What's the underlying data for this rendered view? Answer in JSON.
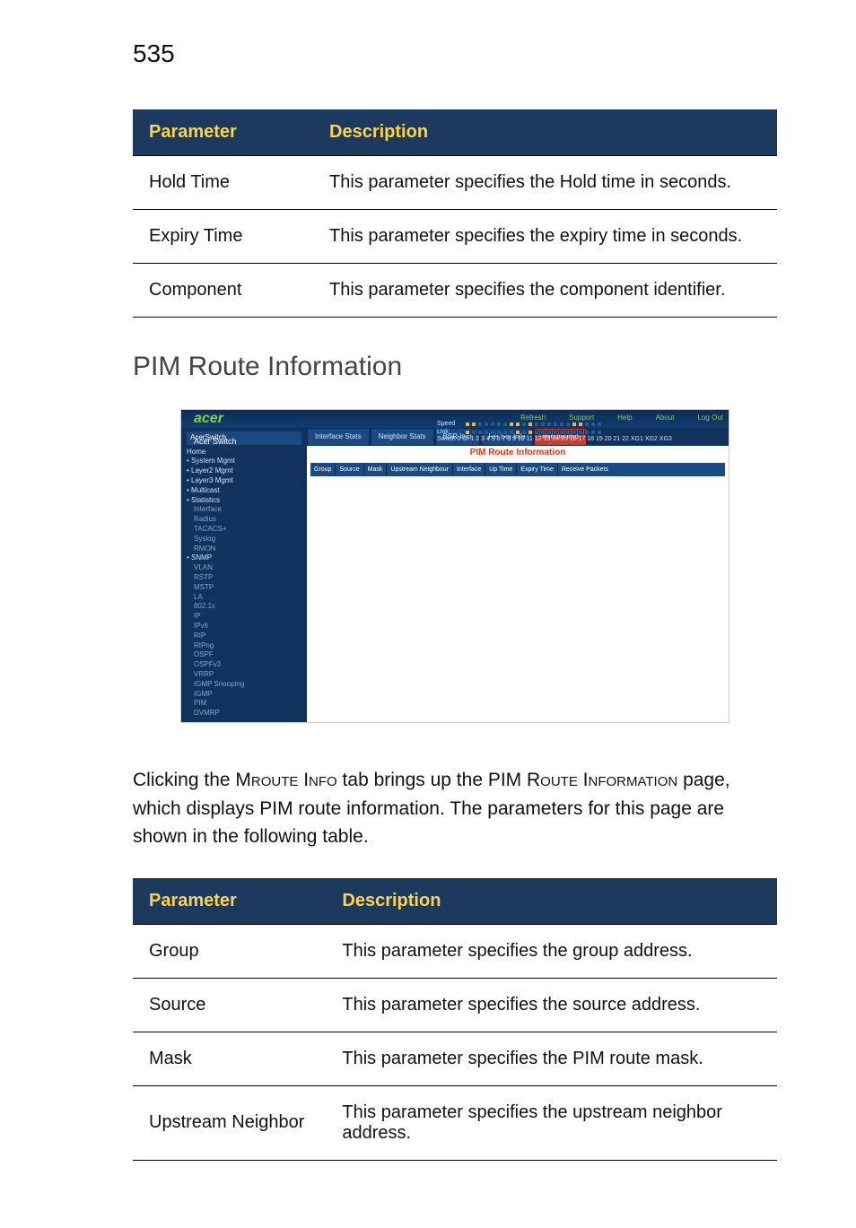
{
  "page_number": "535",
  "table1": {
    "header_param": "Parameter",
    "header_desc": "Description",
    "rows": [
      {
        "p": "Hold Time",
        "d": "This parameter specifies the Hold time in seconds."
      },
      {
        "p": "Expiry Time",
        "d": "This parameter specifies the expiry time in seconds."
      },
      {
        "p": "Component",
        "d": "This parameter specifies the component identifier."
      }
    ]
  },
  "section_title": "PIM Route Information",
  "shot": {
    "brand": "acer",
    "brand_sub": "Acer Switch",
    "toplinks": [
      "Refresh",
      "Support",
      "Help",
      "About",
      "Log Out"
    ],
    "led_labels": {
      "speed": "Speed",
      "link": "Link",
      "stack": "Switch 0 Gi 1  2  3  4  5  6  7  8  9 10 11 12 13 14 15 16 17 18 19 20 21 22 XG1 XG2 XG3"
    },
    "sidebar_header": "AcerSwitch",
    "sidebar": [
      {
        "t": "Home",
        "c": "grp"
      },
      {
        "t": "• System Mgmt",
        "c": "grp"
      },
      {
        "t": "• Layer2 Mgmt",
        "c": "grp"
      },
      {
        "t": "• Layer3 Mgmt",
        "c": "grp"
      },
      {
        "t": "• Multicast",
        "c": "grp"
      },
      {
        "t": "• Statistics",
        "c": "grp"
      },
      {
        "t": "Interface",
        "c": "item"
      },
      {
        "t": "Radius",
        "c": "item"
      },
      {
        "t": "TACACS+",
        "c": "item"
      },
      {
        "t": "Syslog",
        "c": "item"
      },
      {
        "t": "RMON",
        "c": "item"
      },
      {
        "t": "• SNMP",
        "c": "grp"
      },
      {
        "t": "VLAN",
        "c": "item"
      },
      {
        "t": "RSTP",
        "c": "item"
      },
      {
        "t": "MSTP",
        "c": "item"
      },
      {
        "t": "LA",
        "c": "item"
      },
      {
        "t": "802.1x",
        "c": "item"
      },
      {
        "t": "IP",
        "c": "item"
      },
      {
        "t": "IPv6",
        "c": "item"
      },
      {
        "t": "RIP",
        "c": "item"
      },
      {
        "t": "RIPng",
        "c": "item"
      },
      {
        "t": "OSPF",
        "c": "item"
      },
      {
        "t": "OSPFv3",
        "c": "item"
      },
      {
        "t": "VRRP",
        "c": "item"
      },
      {
        "t": "IGMP Snooping",
        "c": "item"
      },
      {
        "t": "IGMP",
        "c": "item"
      },
      {
        "t": "PIM",
        "c": "item"
      },
      {
        "t": "DVMRP",
        "c": "item"
      }
    ],
    "tabs": [
      {
        "l": "Interface Stats",
        "a": false
      },
      {
        "l": "Neighbor Stats",
        "a": false
      },
      {
        "l": "BSR Info",
        "a": false
      },
      {
        "l": "RP Set Info",
        "a": false
      },
      {
        "l": "Mroute Info",
        "a": true
      }
    ],
    "page_title": "PIM Route Information",
    "cols": [
      "Group",
      "Source",
      "Mask",
      "Upstream Neighbour",
      "Interface",
      "Up Time",
      "Expiry Time",
      "Receive Packets"
    ]
  },
  "body_prefix": "Clicking the ",
  "body_sc1": "Mroute Info",
  "body_mid": " tab brings up the PIM ",
  "body_sc2": "Route Information",
  "body_suffix": " page, which displays PIM route information. The parameters for this page are shown in the following table.",
  "table2": {
    "header_param": "Parameter",
    "header_desc": "Description",
    "rows": [
      {
        "p": "Group",
        "d": "This parameter specifies the group address."
      },
      {
        "p": "Source",
        "d": "This parameter specifies the source address."
      },
      {
        "p": "Mask",
        "d": "This parameter specifies the PIM route mask."
      },
      {
        "p": "Upstream Neighbor",
        "d": "This parameter specifies the upstream neighbor address."
      }
    ]
  }
}
